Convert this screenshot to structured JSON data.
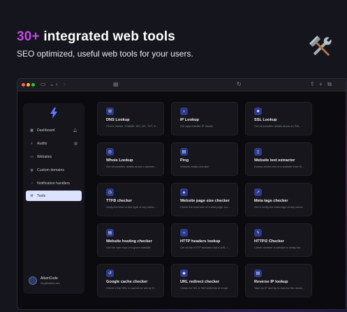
{
  "hero": {
    "headline_accent": "30+",
    "headline_rest": "integrated web tools",
    "subtitle": "SEO optimized, useful web tools for  your users.",
    "emoji_icon": "hammer-and-wrench-icon"
  },
  "colors": {
    "accent_purple": "#c24be6",
    "card_icon_bg": "#2c3a8a",
    "active_nav_bg": "#dbe3ff"
  },
  "sidebar": {
    "items": [
      {
        "label": "Dashboard",
        "icon": "dashboard-icon",
        "badge": "bell-icon"
      },
      {
        "label": "Audits",
        "icon": "bolt-icon",
        "badge": "server-icon"
      },
      {
        "label": "Websites",
        "icon": "monitor-icon"
      },
      {
        "label": "Custom domains",
        "icon": "globe-icon"
      },
      {
        "label": "Notification handlers",
        "icon": "bell-icon"
      },
      {
        "label": "Tools",
        "icon": "tools-icon",
        "active": true
      }
    ],
    "user": {
      "name": "AltumCode",
      "email": "hey@altum.dev"
    }
  },
  "tools": [
    {
      "title": "DNS Lookup",
      "desc": "Find A, AAAA, CNAME, MX, NS, TXT, S...",
      "icon": "network-icon"
    },
    {
      "title": "IP Lookup",
      "desc": "Get approximate IP details",
      "icon": "search-icon"
    },
    {
      "title": "SSL Lookup",
      "desc": "Get all possible details about an SSL...",
      "icon": "lock-icon"
    },
    {
      "title": "Whois Lookup",
      "desc": "Get all possible details about a domain...",
      "icon": "fingerprint-icon"
    },
    {
      "title": "Ping",
      "desc": "Website status checker",
      "icon": "server-icon"
    },
    {
      "title": "Website text extractor",
      "desc": "Extract all the text of a website from th...",
      "icon": "document-icon"
    },
    {
      "title": "TTFB checker",
      "desc": "Verify the time to first byte of any webs...",
      "icon": "stopwatch-icon"
    },
    {
      "title": "Website page size checker",
      "desc": "Check the total size of a web page, inc...",
      "icon": "warning-icon"
    },
    {
      "title": "Meta tags checker",
      "desc": "Get & verify the meta tags of any webs...",
      "icon": "external-link-icon"
    },
    {
      "title": "Website hosting checker",
      "desc": "Get the web host of a given website.",
      "icon": "server-icon"
    },
    {
      "title": "HTTP headers lookup",
      "desc": "Get all the HTTP headers that a URL r...",
      "icon": "code-icon"
    },
    {
      "title": "HTTP/2 Checker",
      "desc": "Check whether a website is using the ...",
      "icon": "bolt-icon"
    },
    {
      "title": "Google cache checker",
      "desc": "Check if the URL is cached or not by G...",
      "icon": "history-icon"
    },
    {
      "title": "URL redirect checker",
      "desc": "Check for 301 & 302 redirects of a spe...",
      "icon": "directions-icon"
    },
    {
      "title": "Reverse IP lookup",
      "desc": "Take an IP and try to look for the doma...",
      "icon": "server-icon"
    }
  ]
}
